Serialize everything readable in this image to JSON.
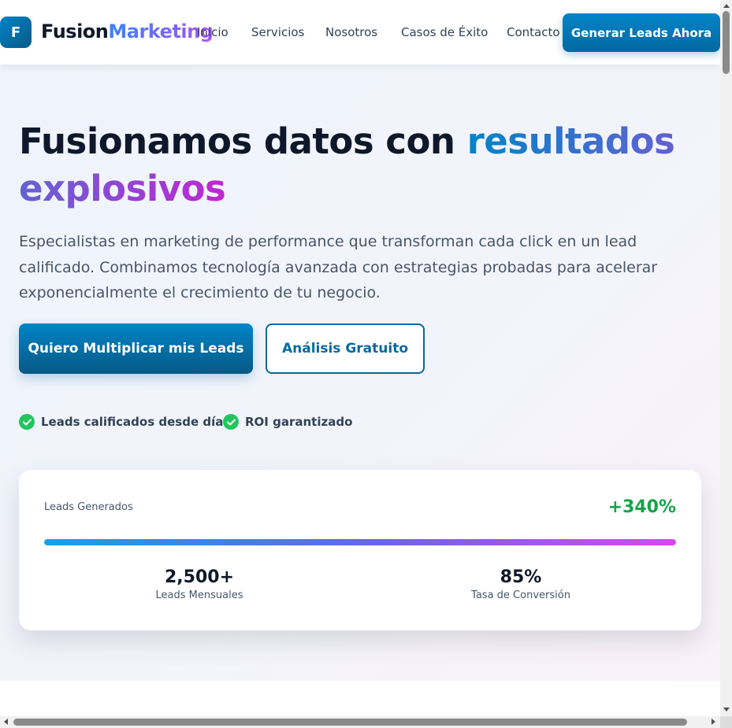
{
  "brand": {
    "mark": "F",
    "name_part1": "Fusion",
    "name_part2": "Marketing"
  },
  "nav": {
    "links": [
      {
        "label": "Inicio"
      },
      {
        "label": "Servicios"
      },
      {
        "label": "Nosotros"
      },
      {
        "label": "Casos de Éxito"
      },
      {
        "label": "Contacto"
      }
    ],
    "cta_label": "Generar Leads Ahora"
  },
  "hero": {
    "title_plain": "Fusionamos datos con ",
    "title_highlight": "resultados explosivos",
    "subtitle": "Especialistas en marketing de performance que transforman cada click en un lead calificado. Combinamos tecnología avanzada con estrategias probadas para acelerar exponencialmente el crecimiento de tu negocio.",
    "primary_cta": "Quiero Multiplicar mis Leads",
    "secondary_cta": "Análisis Gratuito",
    "features": [
      {
        "label": "Leads calificados desde día 1",
        "icon": "check-circle-icon"
      },
      {
        "label": "ROI garantizado",
        "icon": "check-circle-icon"
      }
    ]
  },
  "stats_card": {
    "label": "Leads Generados",
    "growth": "+340%",
    "progress_fraction": 1.0,
    "stats": [
      {
        "value": "2,500+",
        "label": "Leads Mensuales"
      },
      {
        "value": "85%",
        "label": "Tasa de Conversión"
      }
    ]
  },
  "colors": {
    "primary": "#0369a1",
    "success": "#22c55e",
    "gradient_start": "#0284c7",
    "gradient_end": "#c026d3"
  }
}
